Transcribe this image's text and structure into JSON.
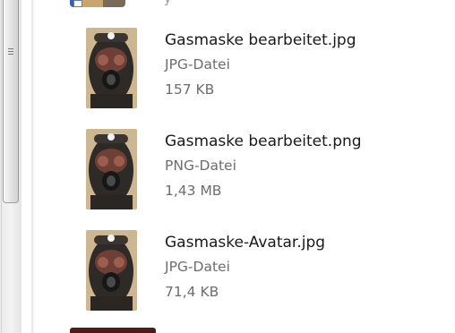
{
  "scrollbar": {
    "thumb_icon": "grip-lines-icon"
  },
  "files": [
    {
      "name": "Gasmaske bearbeitet.jpg",
      "type": "JPG-Datei",
      "size": "157 KB",
      "thumbnail_icon": "gas-mask-image-icon"
    },
    {
      "name": "Gasmaske bearbeitet.png",
      "type": "PNG-Datei",
      "size": "1,43 MB",
      "thumbnail_icon": "gas-mask-image-icon"
    },
    {
      "name": "Gasmaske-Avatar.jpg",
      "type": "JPG-Datei",
      "size": "71,4 KB",
      "thumbnail_icon": "gas-mask-image-icon"
    }
  ],
  "partial_top_item": {
    "text": "y"
  }
}
